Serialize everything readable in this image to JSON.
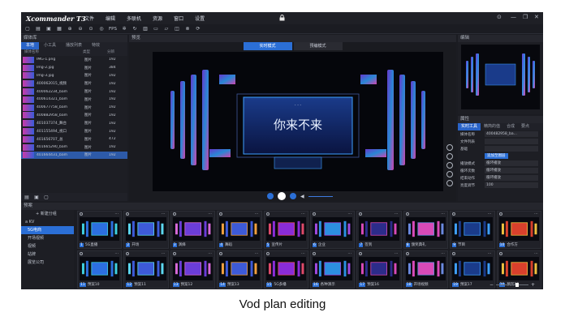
{
  "app": {
    "title": "Xcommander T3",
    "menu": [
      "文件",
      "编辑",
      "多联机",
      "资源",
      "窗口",
      "设置"
    ],
    "window_controls": [
      "⊙",
      "—",
      "❐",
      "✕"
    ]
  },
  "toolbar": {
    "fps_label": "FPS"
  },
  "media_library": {
    "title": "媒体库",
    "tabs": [
      "本地",
      "小工具",
      "播放列表",
      "特效"
    ],
    "columns": [
      "媒体名称",
      "类型",
      "分辨"
    ],
    "rows": [
      {
        "name": "IMG-1.png",
        "type": "图片",
        "dur": "192"
      },
      {
        "name": "Img-2.jpg",
        "type": "图片",
        "dur": "384"
      },
      {
        "name": "Img-3.jpg",
        "type": "图片",
        "dur": "192"
      },
      {
        "name": "400062015_视频",
        "type": "图片",
        "dur": "192"
      },
      {
        "name": "400062234_bam",
        "type": "图片",
        "dur": "192"
      },
      {
        "name": "400614321_bam",
        "type": "图片",
        "dur": "192"
      },
      {
        "name": "400677758_bam",
        "type": "图片",
        "dur": "192"
      },
      {
        "name": "400882958_bam",
        "type": "图片",
        "dur": "192"
      },
      {
        "name": "401037374_舞台",
        "type": "图片",
        "dur": "192"
      },
      {
        "name": "401155494_视口",
        "type": "图片",
        "dur": "192"
      },
      {
        "name": "401656707_总",
        "type": "图片",
        "dur": "472"
      },
      {
        "name": "401665290_bam",
        "type": "图片",
        "dur": "192"
      },
      {
        "name": "401664431_bam",
        "type": "图片",
        "dur": "192"
      }
    ]
  },
  "preview": {
    "title": "预览",
    "tabs": [
      "实时模式",
      "预编模式"
    ],
    "stage_title": "你来不来"
  },
  "editor": {
    "title": "编辑"
  },
  "properties": {
    "title": "属性",
    "tabs": [
      "实时工具",
      "精简的值",
      "合成",
      "要点"
    ],
    "rows": [
      {
        "label": "媒体名称",
        "value": "400482958_ba..."
      },
      {
        "label": "文件列表",
        "value": ""
      },
      {
        "label": "基础",
        "value": ""
      },
      {
        "label": "",
        "value": "追加至图层"
      },
      {
        "label": "播放模式",
        "value": "循环播放"
      },
      {
        "label": "循环次数",
        "value": "循环播放"
      },
      {
        "label": "结束动作",
        "value": "循环播放"
      },
      {
        "label": "亮度调节",
        "value": "100"
      }
    ]
  },
  "plan": {
    "title": "预案",
    "tree": [
      {
        "label": "+ 新建分组",
        "kind": "add"
      },
      {
        "label": "a KV",
        "kind": "root"
      },
      {
        "label": "5G电商",
        "kind": "selected"
      },
      {
        "label": "开场视频",
        "kind": "item"
      },
      {
        "label": "视频",
        "kind": "item"
      },
      {
        "label": "站牌",
        "kind": "item"
      },
      {
        "label": "展览公司",
        "kind": "item"
      }
    ],
    "cards": [
      {
        "num": "1",
        "label": "5G直播"
      },
      {
        "num": "2",
        "label": "开场"
      },
      {
        "num": "3",
        "label": "演绎"
      },
      {
        "num": "4",
        "label": "舞蹈"
      },
      {
        "num": "5",
        "label": "宣传片"
      },
      {
        "num": "6",
        "label": "企业"
      },
      {
        "num": "7",
        "label": "签到"
      },
      {
        "num": "8",
        "label": "颁奖典礼"
      },
      {
        "num": "9",
        "label": "节目"
      },
      {
        "num": "10",
        "label": "合作方"
      },
      {
        "num": "11",
        "label": "预案10"
      },
      {
        "num": "12",
        "label": "预案11"
      },
      {
        "num": "13",
        "label": "预案12"
      },
      {
        "num": "14",
        "label": "预案13"
      },
      {
        "num": "15",
        "label": "5G多播"
      },
      {
        "num": "16",
        "label": "各种演示"
      },
      {
        "num": "17",
        "label": "预案16"
      },
      {
        "num": "18",
        "label": "开场视频"
      },
      {
        "num": "19",
        "label": "预案17"
      },
      {
        "num": "20",
        "label": "预案18"
      }
    ]
  },
  "caption": "Vod plan editing"
}
